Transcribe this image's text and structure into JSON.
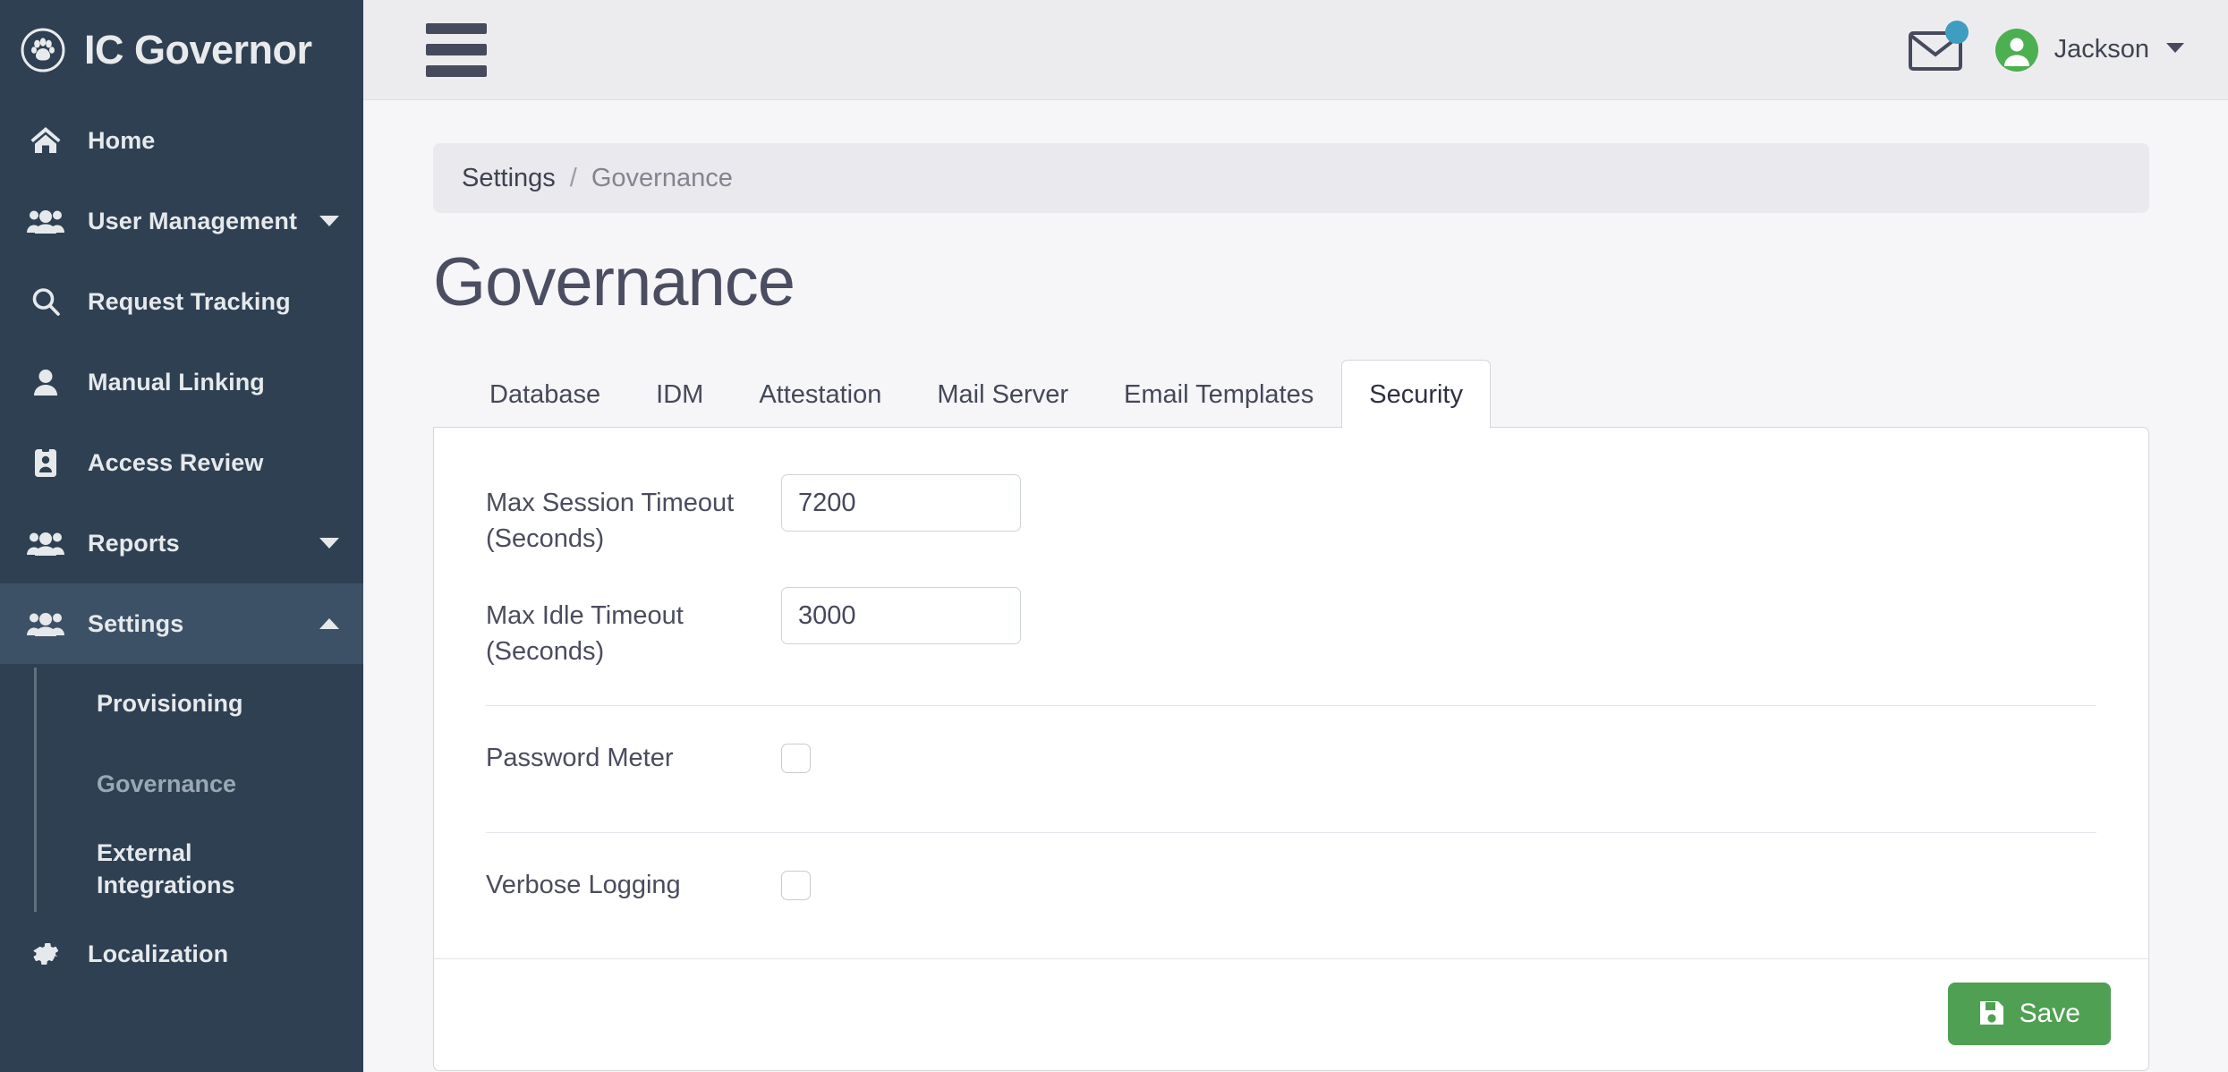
{
  "brand": {
    "title": "IC Governor",
    "logo_icon": "paw-circle-icon"
  },
  "sidebar": {
    "items": [
      {
        "label": "Home",
        "icon": "home-icon",
        "caret": "",
        "active": false
      },
      {
        "label": "User Management",
        "icon": "users-icon",
        "caret": "chevron-down-icon",
        "active": false
      },
      {
        "label": "Request Tracking",
        "icon": "search-icon",
        "caret": "",
        "active": false
      },
      {
        "label": "Manual Linking",
        "icon": "user-icon",
        "caret": "",
        "active": false
      },
      {
        "label": "Access Review",
        "icon": "id-badge-icon",
        "caret": "",
        "active": false
      },
      {
        "label": "Reports",
        "icon": "users-icon",
        "caret": "chevron-down-icon",
        "active": false
      },
      {
        "label": "Settings",
        "icon": "users-icon",
        "caret": "chevron-up-icon",
        "active": true
      }
    ],
    "submenu": [
      {
        "label": "Provisioning",
        "current": false
      },
      {
        "label": "Governance",
        "current": true
      },
      {
        "label": "External Integrations",
        "current": false
      }
    ],
    "footer_item": {
      "label": "Localization",
      "icon": "gear-icon"
    }
  },
  "topbar": {
    "menu_icon": "hamburger-icon",
    "mail_icon": "envelope-icon",
    "mail_badge": true,
    "avatar_icon": "user-avatar-icon",
    "user_name": "Jackson",
    "user_caret": "chevron-down-icon"
  },
  "breadcrumb": {
    "root": "Settings",
    "separator": "/",
    "current": "Governance"
  },
  "page": {
    "title": "Governance"
  },
  "tabs": [
    {
      "label": "Database",
      "active": false
    },
    {
      "label": "IDM",
      "active": false
    },
    {
      "label": "Attestation",
      "active": false
    },
    {
      "label": "Mail Server",
      "active": false
    },
    {
      "label": "Email Templates",
      "active": false
    },
    {
      "label": "Security",
      "active": true
    }
  ],
  "form": {
    "fields": [
      {
        "label": "Max Session Timeout (Seconds)",
        "value": "7200",
        "placeholder": ""
      },
      {
        "label": "Max Idle Timeout (Seconds)",
        "value": "3000",
        "placeholder": ""
      }
    ],
    "toggles": [
      {
        "label": "Password Meter",
        "checked": false
      },
      {
        "label": "Verbose Logging",
        "checked": false
      }
    ],
    "save_label": "Save",
    "save_icon": "floppy-save-icon"
  },
  "colors": {
    "sidebar_bg": "#2e4052",
    "sidebar_active": "#3d5166",
    "accent_green": "#4fa052",
    "avatar_green": "#4caf50",
    "badge_blue": "#3e9dc0",
    "page_bg": "#f6f6f8",
    "topbar_bg": "#ececee"
  }
}
